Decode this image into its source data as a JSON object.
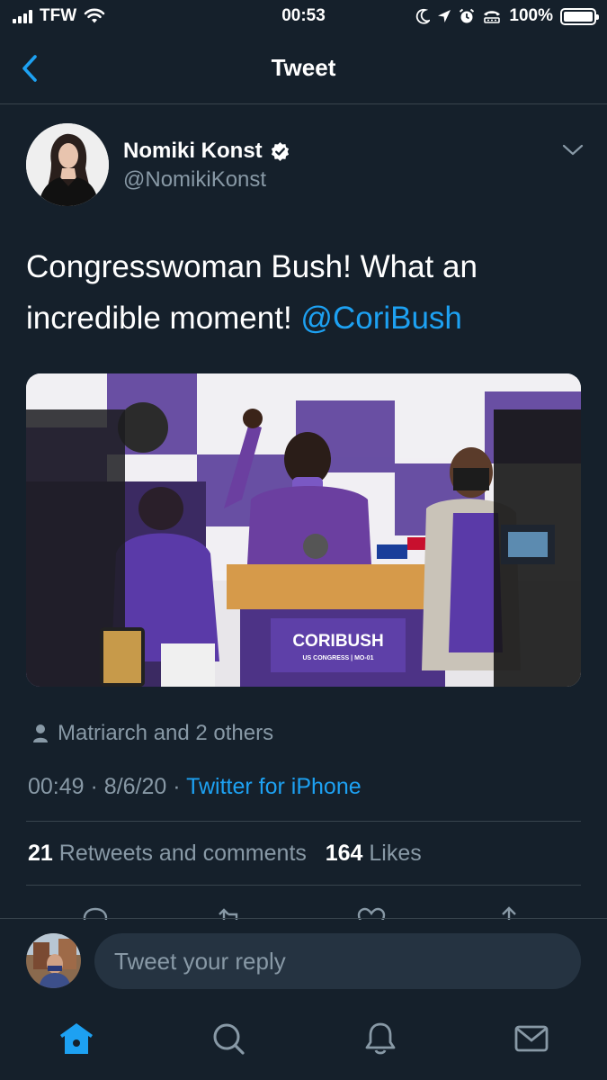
{
  "status_bar": {
    "carrier": "TFW",
    "time": "00:53",
    "battery": "100%"
  },
  "nav": {
    "title": "Tweet"
  },
  "tweet": {
    "author_name": "Nomiki Konst",
    "handle": "@NomikiKonst",
    "text": "Congresswoman Bush! What an incredible moment! ",
    "mention": "@CoriBush",
    "liked_by": "Matriarch and 2 others",
    "time": "00:49",
    "date": "8/6/20",
    "dot": "·",
    "source": "Twitter for iPhone",
    "retweets_count": "21",
    "retweets_label": "Retweets and comments",
    "likes_count": "164",
    "likes_label": "Likes"
  },
  "media": {
    "banner_name": "CORIBUSH",
    "banner_sub": "US CONGRESS | MO-01"
  },
  "reply": {
    "placeholder": "Tweet your reply"
  },
  "icons": {
    "back": "chevron-left-icon",
    "verified": "verified-badge-icon",
    "more": "chevron-down-icon",
    "home": "home-icon",
    "search": "search-icon",
    "notifications": "bell-icon",
    "messages": "mail-icon"
  },
  "colors": {
    "background": "#15202b",
    "accent": "#1da1f2",
    "secondary_text": "#8899a6",
    "divider": "#38444d"
  }
}
